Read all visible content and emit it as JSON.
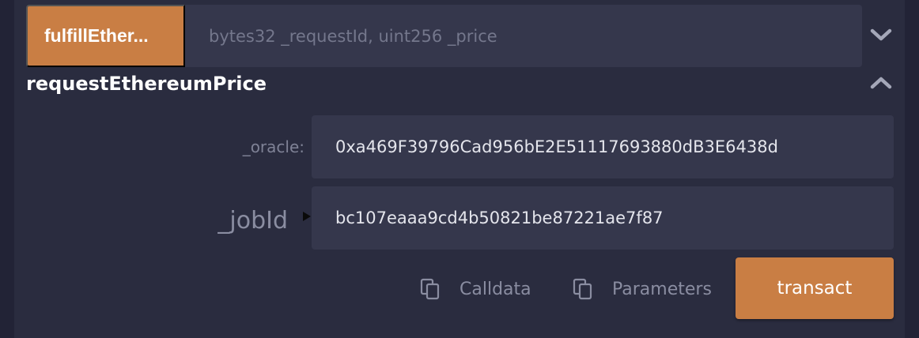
{
  "fulfill": {
    "button_label": "fulfillEther...",
    "placeholder": "bytes32 _requestId, uint256 _price",
    "expand_icon": "chevron-down-icon"
  },
  "request": {
    "title": "requestEthereumPrice",
    "collapse_icon": "chevron-up-icon",
    "params": [
      {
        "label": "_oracle:",
        "value": "0xa469F39796Cad956bE2E51117693880dB3E6438d"
      },
      {
        "label": "_jobId",
        "value": "bc107eaaa9cd4b50821be87221ae7f87"
      }
    ],
    "actions": {
      "calldata_label": "Calldata",
      "parameters_label": "Parameters",
      "transact_label": "transact"
    }
  },
  "colors": {
    "accent": "#c97e44",
    "panel": "#2a2c3f",
    "input_bg": "#35374c",
    "background": "#222336"
  }
}
